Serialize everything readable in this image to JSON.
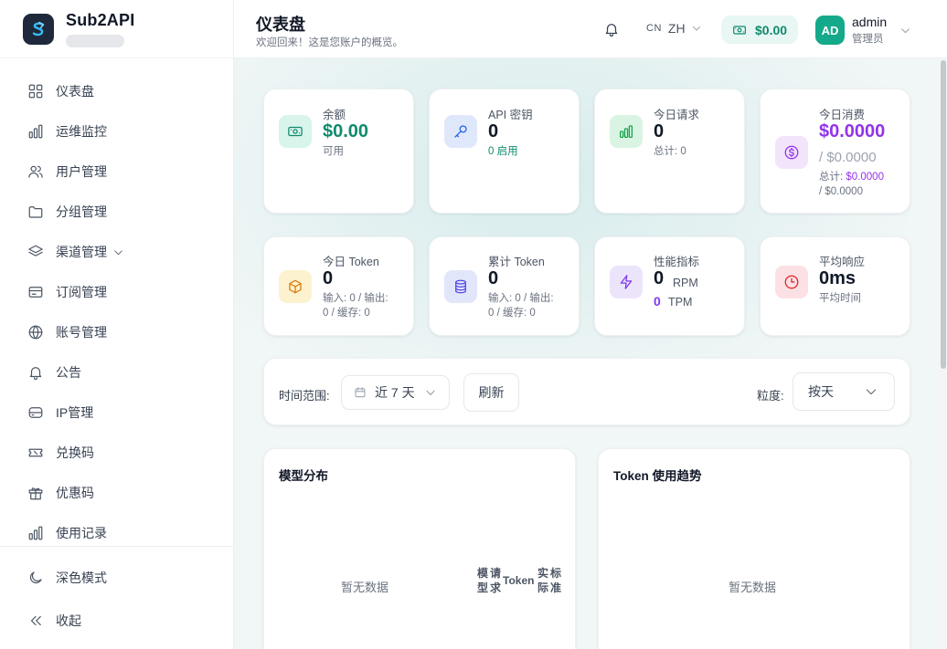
{
  "brand": {
    "name": "Sub2API"
  },
  "sidebar": {
    "items": [
      {
        "label": "仪表盘"
      },
      {
        "label": "运维监控"
      },
      {
        "label": "用户管理"
      },
      {
        "label": "分组管理"
      },
      {
        "label": "渠道管理"
      },
      {
        "label": "订阅管理"
      },
      {
        "label": "账号管理"
      },
      {
        "label": "公告"
      },
      {
        "label": "IP管理"
      },
      {
        "label": "兑换码"
      },
      {
        "label": "优惠码"
      },
      {
        "label": "使用记录"
      }
    ],
    "dark_mode": "深色模式",
    "collapse": "收起"
  },
  "header": {
    "title": "仪表盘",
    "subtitle": "欢迎回来！这是您账户的概览。",
    "lang_flag": "CN",
    "lang_code": "ZH",
    "balance": "$0.00",
    "avatar_initials": "AD",
    "user_name": "admin",
    "user_role": "管理员"
  },
  "stats": {
    "balance": {
      "label": "余额",
      "value": "$0.00",
      "sub": "可用"
    },
    "api_keys": {
      "label": "API 密钥",
      "value": "0",
      "sub": "0 启用"
    },
    "today_requests": {
      "label": "今日请求",
      "value": "0",
      "sub": "总计: 0"
    },
    "today_cost": {
      "label": "今日消费",
      "value": "$0.0000",
      "value_sub": "/ $0.0000",
      "total_label": "总计:",
      "total_value": "$0.0000",
      "total_sub": "/ $0.0000"
    },
    "today_token": {
      "label": "今日 Token",
      "value": "0",
      "sub1": "输入: 0 / 输出:",
      "sub2": "0 / 缓存: 0"
    },
    "total_token": {
      "label": "累计 Token",
      "value": "0",
      "sub1": "输入: 0 / 输出:",
      "sub2": "0 / 缓存: 0"
    },
    "performance": {
      "label": "性能指标",
      "rpm_value": "0",
      "rpm_unit": "RPM",
      "tpm_value": "0",
      "tpm_unit": "TPM"
    },
    "avg_response": {
      "label": "平均响应",
      "value": "0ms",
      "sub": "平均时间"
    }
  },
  "filters": {
    "range_label": "时间范围:",
    "range_value": "近 7 天",
    "refresh": "刷新",
    "granularity_label": "粒度:",
    "granularity_value": "按天"
  },
  "panels": {
    "model_dist": {
      "title": "模型分布",
      "empty": "暂无数据",
      "col_model": [
        "模",
        "型"
      ],
      "col_requests": [
        "请",
        "求"
      ],
      "col_token": "Token",
      "col_actual": [
        "实",
        "际"
      ],
      "col_standard": [
        "标",
        "准"
      ]
    },
    "token_trend": {
      "title": "Token 使用趋势",
      "empty": "暂无数据"
    }
  },
  "colors": {
    "accent": "#0f8a6e",
    "purple": "#9333ea",
    "brand_dark": "#1e293b",
    "avatar": "#14a98a"
  }
}
